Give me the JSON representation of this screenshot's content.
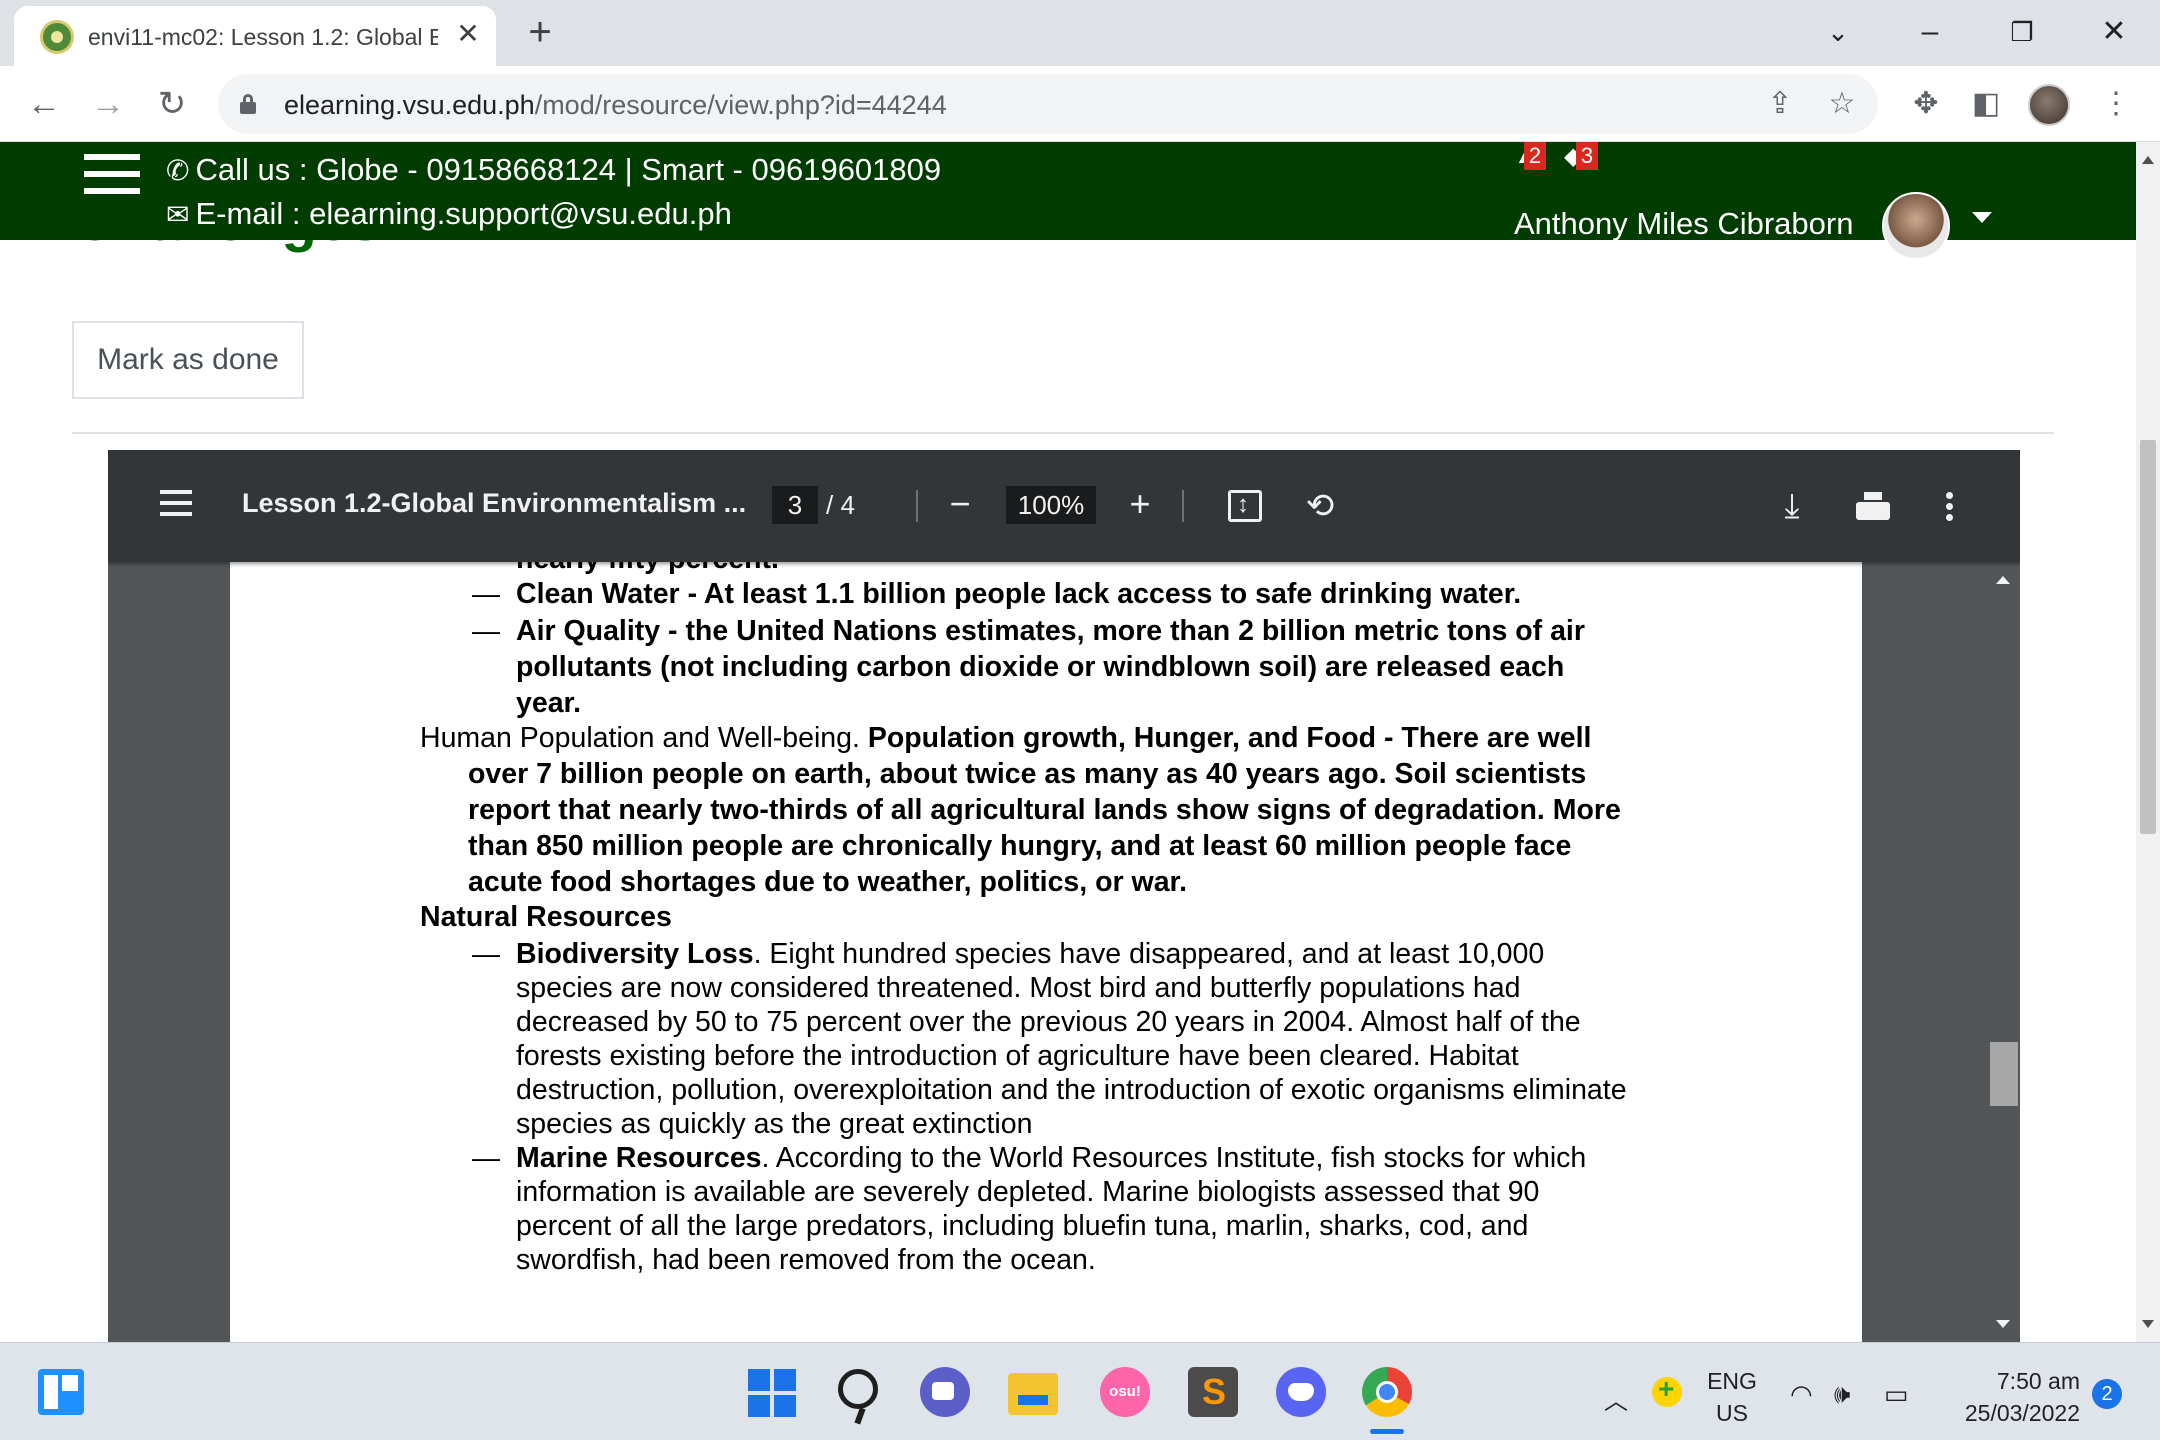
{
  "browser": {
    "tab_title": "envi11-mc02: Lesson 1.2: Global E",
    "url_host": "elearning.vsu.edu.ph",
    "url_path": "/mod/resource/view.php?id=44244"
  },
  "site_header": {
    "phone_text": "Call us : Globe - 09158668124  |  Smart - 09619601809",
    "email_text": "E-mail : elearning.support@vsu.edu.ph",
    "notification_count": "2",
    "message_count": "3",
    "user_name": "Anthony Miles Cibraborn"
  },
  "page": {
    "heading": "Challenges",
    "mark_done_label": "Mark as done"
  },
  "pdf": {
    "title": "Lesson 1.2-Global Environmentalism ...",
    "current_page": "3",
    "page_separator": "/  4",
    "zoom": "100%",
    "lines": [
      "nearly fifty percent.",
      "Clean Water - At least 1.1 billion people lack access to safe drinking water.",
      "Air Quality - the United Nations estimates, more than 2 billion metric tons of air",
      "pollutants (not including carbon dioxide or windblown soil) are released each",
      "year.",
      "Human Population and Well-being. ",
      "Population growth, Hunger, and Food - There are well",
      "over 7 billion people on earth, about twice as many as 40 years ago. Soil scientists",
      "report that nearly two-thirds of all agricultural lands show signs of degradation. More",
      "than 850 million people are chronically hungry, and at least 60 million people face",
      "acute food shortages due to weather, politics, or war.",
      "Natural Resources",
      "Biodiversity Loss",
      ". Eight hundred species have disappeared, and at least 10,000",
      "species are now considered threatened. Most bird and butterfly populations had",
      "decreased by 50 to 75 percent over the previous 20 years in 2004. Almost half of the",
      "forests existing before the introduction of agriculture have been cleared. Habitat",
      "destruction, pollution, overexploitation and the introduction of exotic organisms eliminate",
      "species as quickly as the great extinction",
      "Marine Resources",
      ". According to the World Resources Institute, fish stocks for which",
      "information is available are severely depleted.  Marine biologists assessed that 90",
      "percent of all the large predators, including bluefin tuna, marlin, sharks, cod, and",
      "swordfish, had been removed from the ocean."
    ],
    "dash": "—"
  },
  "taskbar": {
    "osu_label": "osu!",
    "lang_top": "ENG",
    "lang_bottom": "US",
    "time": "7:50 am",
    "date": "25/03/2022",
    "notification_count": "2"
  }
}
